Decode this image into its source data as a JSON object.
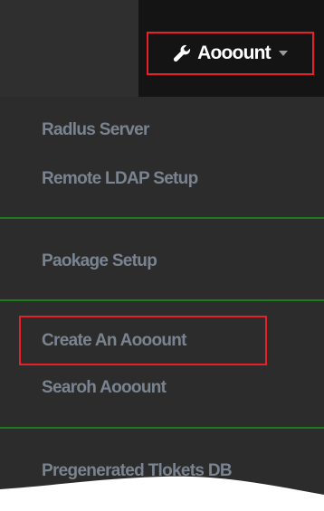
{
  "navbar": {
    "account_label": "Aooount",
    "wrench_icon": "wrench-icon",
    "caret_icon": "caret-down-icon"
  },
  "menu": {
    "items": [
      {
        "label": "Radlus Server"
      },
      {
        "label": "Remote LDAP Setup"
      },
      {
        "label": "Paokage Setup"
      },
      {
        "label": "Create An Aooount"
      },
      {
        "label": "Searoh Aooount"
      },
      {
        "label": "Pregenerated Tlokets DB"
      }
    ]
  },
  "colors": {
    "highlight": "#e8202a",
    "divider": "#1e7a1e",
    "menu_text": "#7a8490",
    "dropdown_bg": "#2c2c2c",
    "navbar_bg": "#141414"
  }
}
